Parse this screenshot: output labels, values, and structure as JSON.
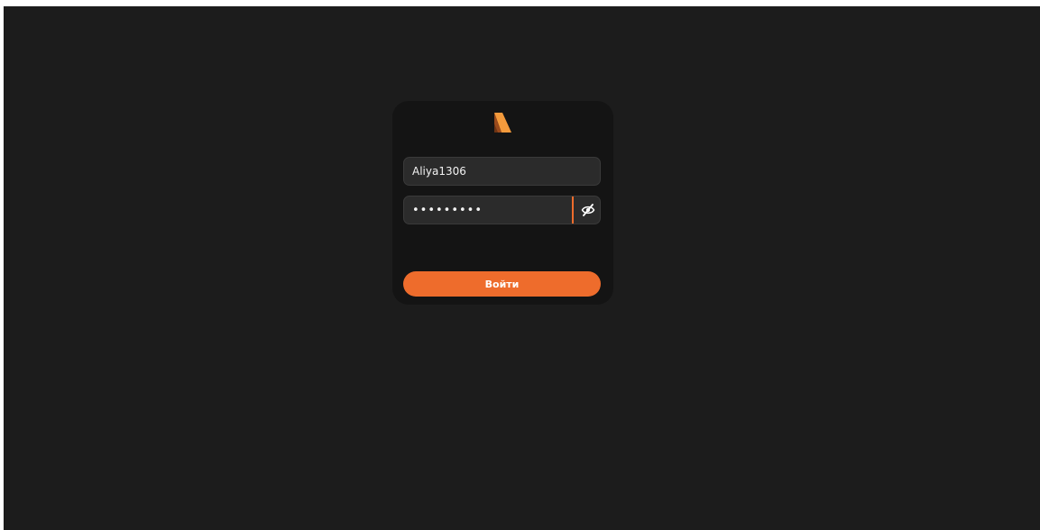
{
  "login": {
    "logo_icon": "brand-logo-icon",
    "username_value": "Aliya1306",
    "password_masked": "•••••••••",
    "eye_icon": "eye-slash-icon",
    "submit_label": "Войти"
  },
  "colors": {
    "background": "#1c1c1c",
    "card": "#141414",
    "field": "#2b2b2b",
    "accent": "#ee6c2c"
  }
}
